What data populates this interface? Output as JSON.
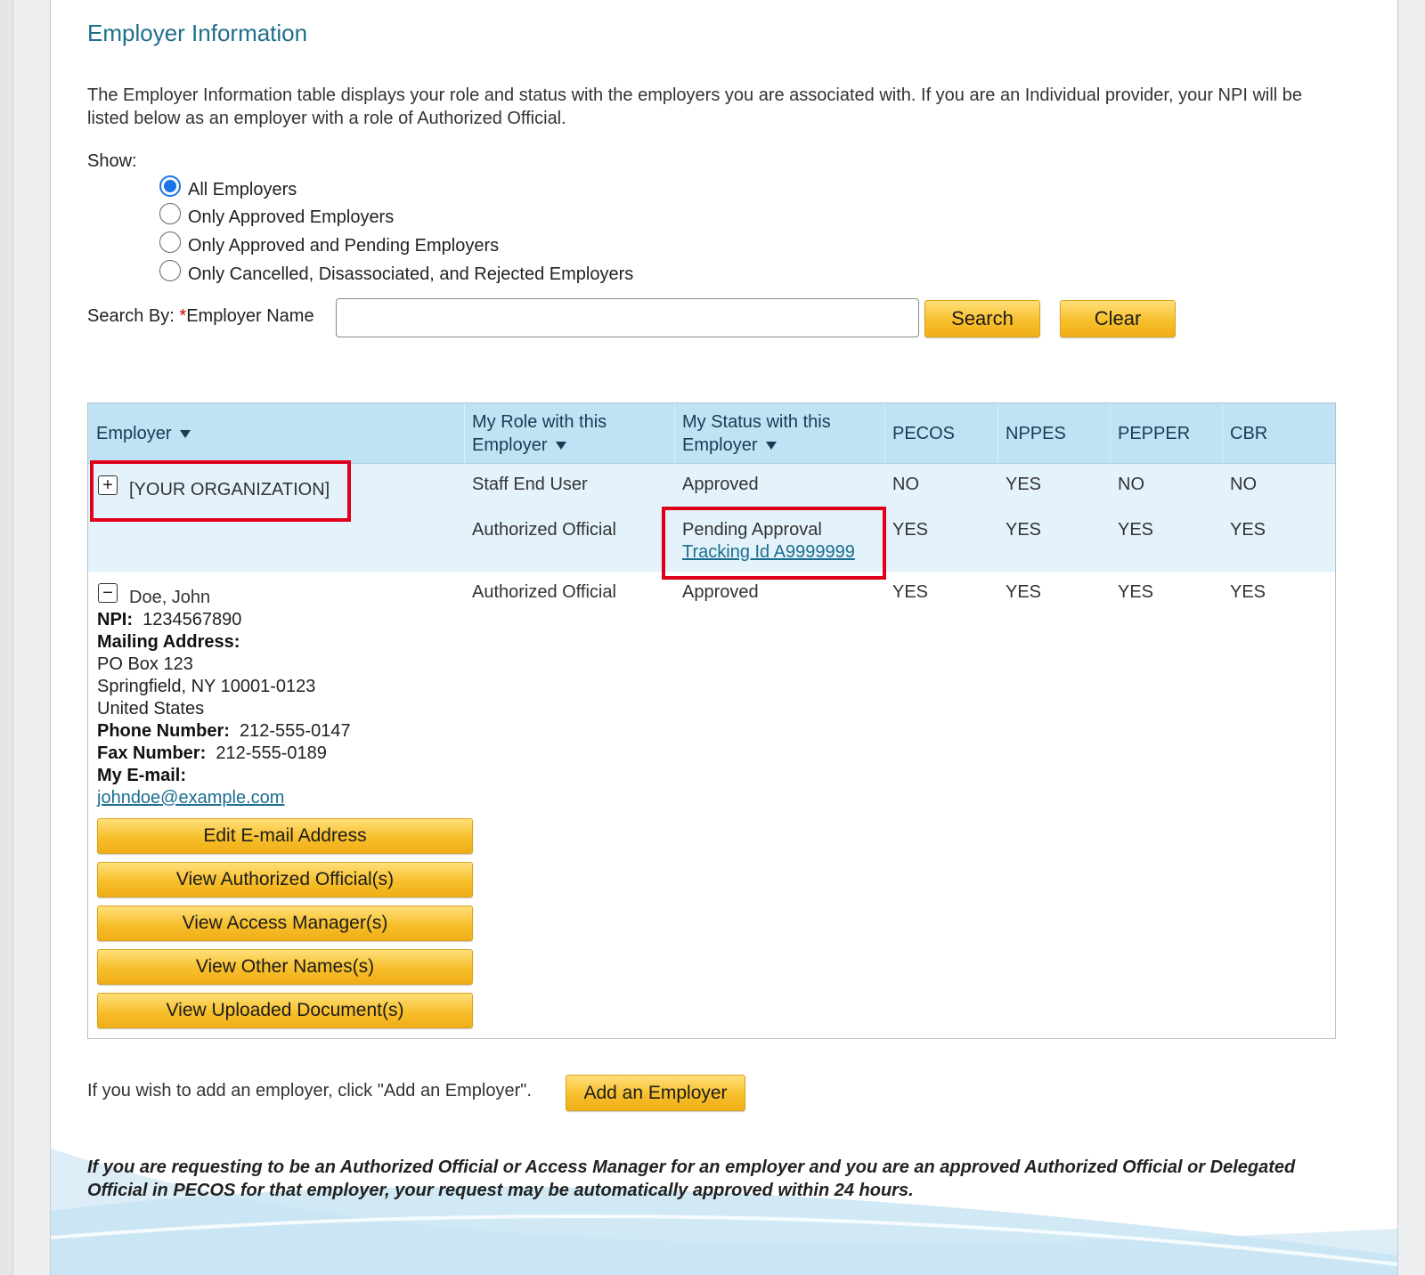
{
  "page": {
    "title": "Employer Information",
    "intro": "The Employer Information table displays your role and status with the employers you are associated with. If you are an Individual provider, your NPI will be listed below as an employer with a role of Authorized Official."
  },
  "filter": {
    "show_label": "Show:",
    "options": [
      {
        "label": "All Employers",
        "selected": true
      },
      {
        "label": "Only Approved Employers",
        "selected": false
      },
      {
        "label": "Only Approved and Pending Employers",
        "selected": false
      },
      {
        "label": "Only Cancelled, Disassociated, and Rejected Employers",
        "selected": false
      }
    ]
  },
  "search": {
    "label_prefix": "Search By: ",
    "required_mark": "*",
    "field_label": "Employer Name",
    "value": "",
    "search_button": "Search",
    "clear_button": "Clear"
  },
  "table": {
    "headers": {
      "employer": "Employer",
      "role_line1": "My Role with this",
      "role_line2": "Employer",
      "status_line1": "My Status with this",
      "status_line2": "Employer",
      "pecos": "PECOS",
      "nppes": "NPPES",
      "pepper": "PEPPER",
      "cbr": "CBR"
    },
    "rows": [
      {
        "employer": "[YOUR ORGANIZATION]",
        "toggle": "+",
        "entries": [
          {
            "role": "Staff End User",
            "status": "Approved",
            "pecos": "NO",
            "nppes": "YES",
            "pepper": "NO",
            "cbr": "NO"
          },
          {
            "role": "Authorized Official",
            "status": "Pending Approval",
            "tracking": "Tracking Id A9999999",
            "pecos": "YES",
            "nppes": "YES",
            "pepper": "YES",
            "cbr": "YES"
          }
        ]
      },
      {
        "employer": "Doe, John",
        "toggle": "−",
        "entries": [
          {
            "role": "Authorized Official",
            "status": "Approved",
            "pecos": "YES",
            "nppes": "YES",
            "pepper": "YES",
            "cbr": "YES"
          }
        ],
        "details": {
          "npi_label": "NPI:",
          "npi": "1234567890",
          "mailing_label": "Mailing Address:",
          "address1": "PO Box 123",
          "address2": "Springfield, NY 10001-0123",
          "country": "United States",
          "phone_label": "Phone Number:",
          "phone": "212-555-0147",
          "fax_label": "Fax Number:",
          "fax": "212-555-0189",
          "email_label": "My E-mail:",
          "email": "johndoe@example.com"
        },
        "buttons": [
          "Edit E-mail Address",
          "View Authorized Official(s)",
          "View Access Manager(s)",
          "View Other Names(s)",
          "View Uploaded Document(s)"
        ]
      }
    ]
  },
  "add_employer": {
    "text": "If you wish to add an employer, click \"Add an Employer\".",
    "button": "Add an Employer"
  },
  "footnote": "If you are requesting to be an Authorized Official or Access Manager for an employer and you are an approved Authorized Official or Delegated Official in PECOS for that employer, your request may be automatically approved within 24 hours.",
  "colors": {
    "title": "#1f6f8b",
    "header_bg": "#bfe3f5",
    "row_highlight": "#e4f3fb",
    "button_gold": "#f7bf2c",
    "annotation_red": "#e0001a",
    "link": "#1a6d8f"
  }
}
